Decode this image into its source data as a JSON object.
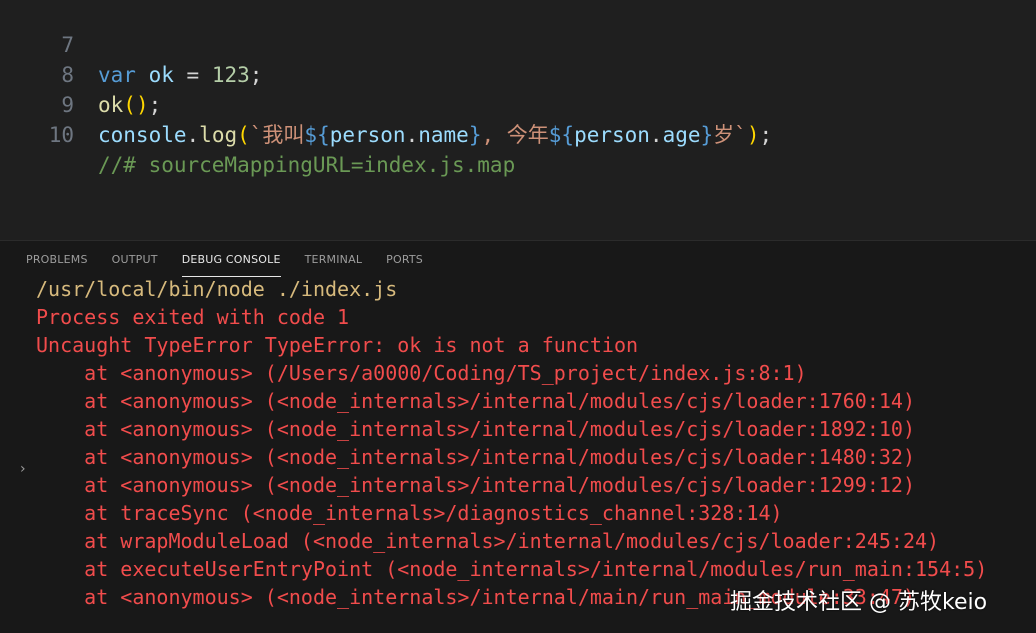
{
  "editor": {
    "lines": [
      {
        "number": "7",
        "parts": [
          "var",
          " ",
          "ok",
          " = ",
          "123",
          ";"
        ]
      },
      {
        "number": "8",
        "parts": [
          "ok",
          "(",
          ")",
          ";"
        ]
      },
      {
        "number": "9",
        "parts": [
          "console",
          ".",
          "log",
          "(",
          "`我叫",
          "${",
          "person",
          ".",
          "name",
          "}",
          ", 今年",
          "${",
          "person",
          ".",
          "age",
          "}",
          "岁`",
          ")",
          ";"
        ]
      },
      {
        "number": "10",
        "parts": [
          "//# sourceMappingURL=index.js.map"
        ]
      }
    ]
  },
  "panel": {
    "tabs": [
      "PROBLEMS",
      "OUTPUT",
      "DEBUG CONSOLE",
      "TERMINAL",
      "PORTS"
    ],
    "active_tab": "DEBUG CONSOLE",
    "chevron": "›",
    "console": [
      "/usr/local/bin/node ./index.js",
      "Process exited with code 1",
      "Uncaught TypeError TypeError: ok is not a function",
      "    at <anonymous> (/Users/a0000/Coding/TS_project/index.js:8:1)",
      "    at <anonymous> (<node_internals>/internal/modules/cjs/loader:1760:14)",
      "    at <anonymous> (<node_internals>/internal/modules/cjs/loader:1892:10)",
      "    at <anonymous> (<node_internals>/internal/modules/cjs/loader:1480:32)",
      "    at <anonymous> (<node_internals>/internal/modules/cjs/loader:1299:12)",
      "    at traceSync (<node_internals>/diagnostics_channel:328:14)",
      "    at wrapModuleLoad (<node_internals>/internal/modules/cjs/loader:245:24)",
      "    at executeUserEntryPoint (<node_internals>/internal/modules/run_main:154:5)",
      "    at <anonymous> (<node_internals>/internal/main/run_main_module:33:47)"
    ]
  },
  "watermark": "掘金技术社区 @ 苏牧keio",
  "colors": {
    "background": "#1f1f1f",
    "panel_background": "#181818",
    "command_color": "#d7ba7d",
    "error_color": "#f14c4c"
  }
}
